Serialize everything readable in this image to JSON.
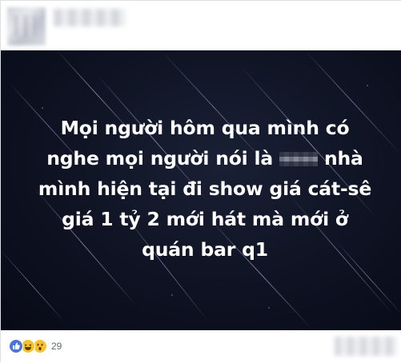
{
  "post": {
    "text_line1": "Mọi người hôm qua mình có",
    "text_line2_a": "nghe mọi người nói là",
    "text_line2_b": "nhà",
    "text_line3": "mình hiện tại đi show giá cát-sê",
    "text_line4": "giá 1 tỷ 2 mới hát mà mới ở",
    "text_line5": "quán bar q1"
  },
  "reactions": {
    "types": [
      "like-icon",
      "haha-icon",
      "wow-icon"
    ],
    "count": "29"
  },
  "colors": {
    "background_dark": "#0e1222",
    "text": "#ffffff",
    "like_blue": "#4a76d8",
    "emoji_yellow": "#f7c22f"
  }
}
